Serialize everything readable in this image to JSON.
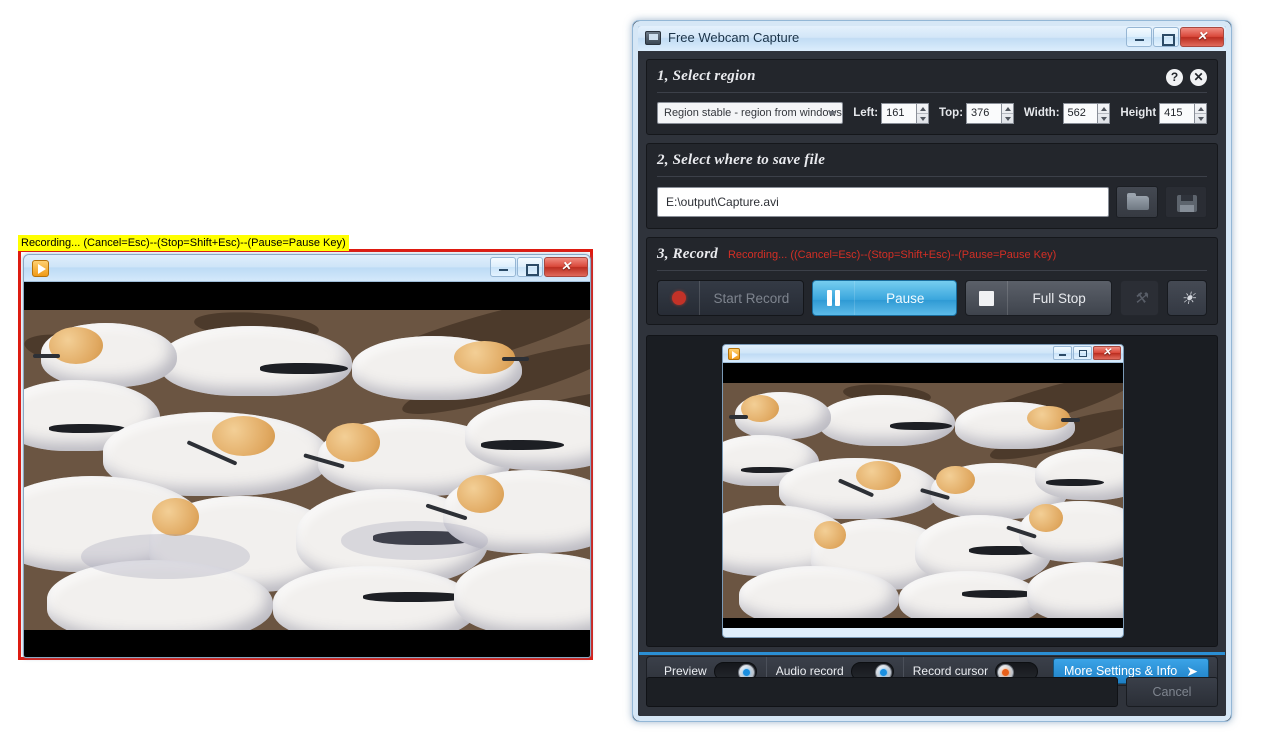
{
  "captured_window": {
    "recording_banner": "Recording... (Cancel=Esc)--(Stop=Shift+Esc)--(Pause=Pause Key)",
    "title": "",
    "app_icon": "play-icon",
    "window_buttons": {
      "minimize": "minimize-icon",
      "maximize": "maximize-icon",
      "close": "close-icon"
    },
    "content_description": "gannet-colony-video-frame"
  },
  "app": {
    "titlebar": {
      "title": "Free Webcam Capture",
      "icon": "webcam-icon",
      "minimize": "minimize-icon",
      "maximize": "maximize-icon",
      "close": "close-icon"
    },
    "section1": {
      "title": "1, Select region",
      "help_icon": "help-icon",
      "close_icon": "close-circle-icon",
      "region_mode": "Region stable - region from windows",
      "fields": [
        {
          "label": "Left:",
          "value": "161"
        },
        {
          "label": "Top:",
          "value": "376"
        },
        {
          "label": "Width:",
          "value": "562"
        },
        {
          "label": "Height",
          "value": "415"
        }
      ]
    },
    "section2": {
      "title": "2, Select where to save file",
      "path_value": "E:\\output\\Capture.avi",
      "path_placeholder": "E:\\output\\Capture.avi",
      "browse_icon": "folder-icon",
      "save_icon": "save-disk-icon"
    },
    "section3": {
      "title": "3, Record",
      "status": "Recording... ((Cancel=Esc)--(Stop=Shift+Esc)--(Pause=Pause Key)",
      "buttons": {
        "start": {
          "label": "Start Record",
          "icon": "record-dot-icon",
          "enabled": false
        },
        "pause": {
          "label": "Pause",
          "icon": "pause-icon",
          "active": true
        },
        "stop": {
          "label": "Full Stop",
          "icon": "stop-square-icon"
        },
        "tools": {
          "icon": "wrench-icon",
          "glyph": "⚒"
        },
        "brightness": {
          "icon": "sun-icon",
          "glyph": "☀"
        }
      },
      "preview_window": {
        "icon": "play-icon",
        "minimize": "minimize-icon",
        "maximize": "maximize-icon",
        "close": "close-icon"
      }
    },
    "toggles": [
      {
        "label": "Preview",
        "state": "on",
        "name": "preview-toggle"
      },
      {
        "label": "Audio record",
        "state": "on",
        "name": "audio-record-toggle"
      },
      {
        "label": "Record cursor",
        "state": "off",
        "name": "record-cursor-toggle"
      }
    ],
    "more_settings": {
      "label": "More Settings & Info",
      "icon": "send-arrow-icon",
      "glyph": "➤"
    },
    "bottom": {
      "progress_value": "",
      "cancel_label": "Cancel"
    }
  }
}
